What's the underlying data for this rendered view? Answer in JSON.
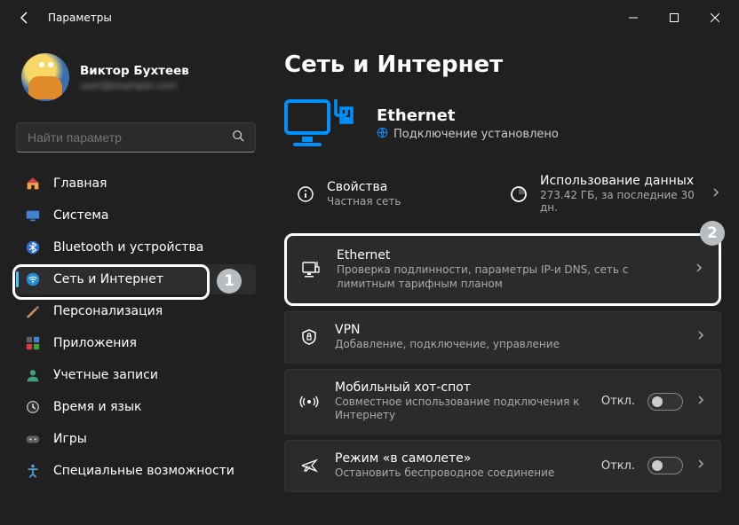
{
  "title": "Параметры",
  "user": {
    "name": "Виктор Бухтеев",
    "email": "user@example.com"
  },
  "search": {
    "placeholder": "Найти параметр"
  },
  "sidebar": {
    "items": [
      {
        "label": "Главная"
      },
      {
        "label": "Система"
      },
      {
        "label": "Bluetooth и устройства"
      },
      {
        "label": "Сеть и Интернет"
      },
      {
        "label": "Персонализация"
      },
      {
        "label": "Приложения"
      },
      {
        "label": "Учетные записи"
      },
      {
        "label": "Время и язык"
      },
      {
        "label": "Игры"
      },
      {
        "label": "Специальные возможности"
      }
    ]
  },
  "page": {
    "heading": "Сеть и Интернет",
    "network": {
      "name": "Ethernet",
      "status": "Подключение установлено"
    },
    "stats": {
      "props": {
        "title": "Свойства",
        "sub": "Частная сеть"
      },
      "usage": {
        "title": "Использование данных",
        "sub": "273.42 ГБ, за последние 30 дн."
      }
    },
    "cards": [
      {
        "title": "Ethernet",
        "sub": "Проверка подлинности, параметры IP-и DNS, сеть с лимитным тарифным планом"
      },
      {
        "title": "VPN",
        "sub": "Добавление, подключение, управление"
      },
      {
        "title": "Мобильный хот-спот",
        "sub": "Совместное использование подключения к Интернету",
        "toggle": "Откл."
      },
      {
        "title": "Режим «в самолете»",
        "sub": "Остановить беспроводное соединение",
        "toggle": "Откл."
      }
    ]
  },
  "callouts": {
    "one": "1",
    "two": "2"
  }
}
